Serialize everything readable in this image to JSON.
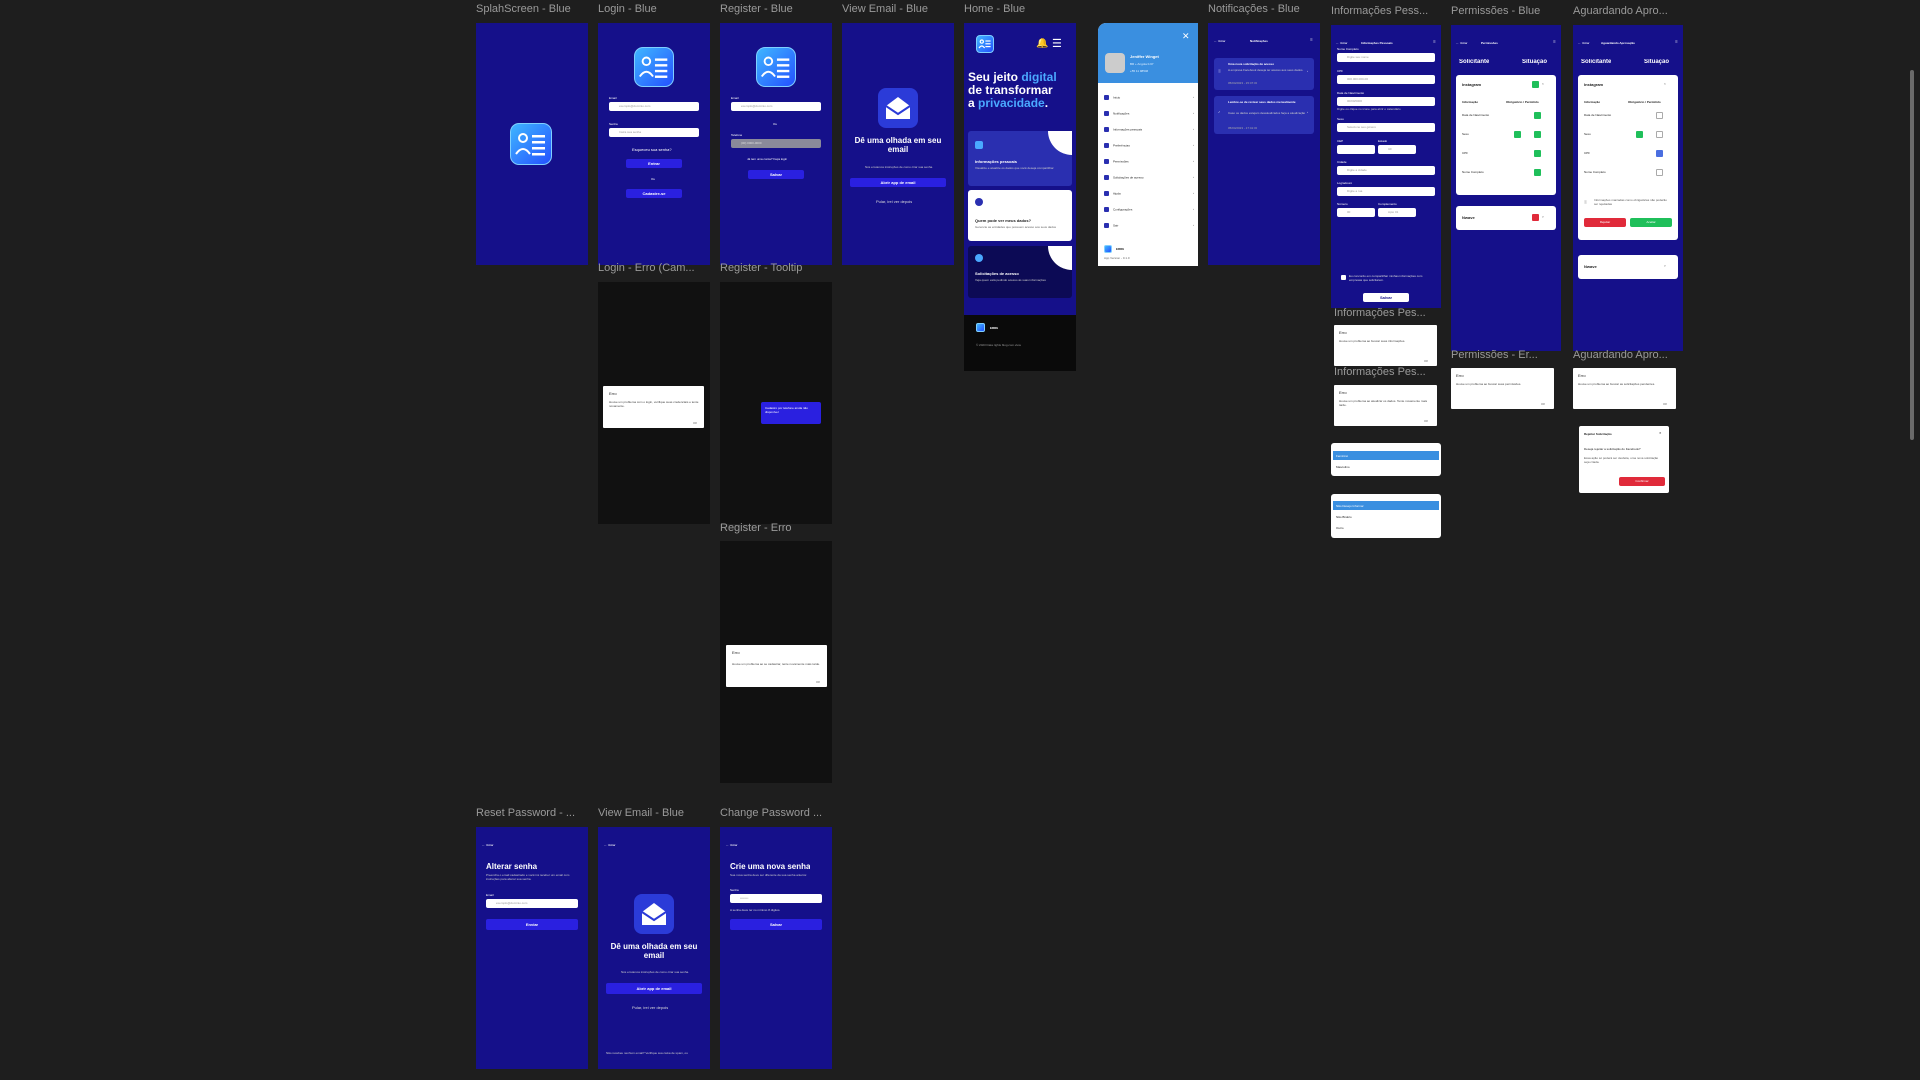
{
  "frames": {
    "splash": "SplahScreen - Blue",
    "login": "Login - Blue",
    "register": "Register - Blue",
    "view_email": "View Email - Blue",
    "home": "Home - Blue",
    "notifications": "Notificações - Blue",
    "personal_info": "Informações Pess...",
    "permissions": "Permissões - Blue",
    "awaiting": "Aguardando Apro...",
    "login_error": "Login - Erro (Cam...",
    "register_tooltip": "Register - Tooltip",
    "register_error": "Register - Erro",
    "personal_info_2": "Informações Pes...",
    "personal_info_3": "Informações Pes...",
    "permissions_error": "Permissões - Er...",
    "awaiting_2": "Aguardando Apro...",
    "reset_password": "Reset Password - ...",
    "view_email_2": "View Email - Blue",
    "change_password": "Change Password ..."
  },
  "login": {
    "email_label": "Email",
    "email_placeholder": "exemplo@dominio.com",
    "password_label": "Senha",
    "password_placeholder": "Insira sua senha",
    "forgot": "Esqueceu sua senha?",
    "enter": "Entrar",
    "or": "Ou",
    "register": "Cadastre-se"
  },
  "register": {
    "email_label": "Email",
    "email_placeholder": "exemplo@dominio.com",
    "or": "Ou",
    "phone_label": "Telefone",
    "phone_placeholder": "(00) 0000-0000",
    "have_account": "Já tem uma conta? Faça login",
    "save": "Salvar",
    "tooltip": "Cadastro por telefone ainda não disponível"
  },
  "view_email": {
    "title": "Dê uma olhada em seu email",
    "desc": "Nós enviamos instruções de como criar sua senha.",
    "open_app": "Abrir app de email",
    "skip": "Pular, irei ver depois",
    "footer": "Não recebeu nenhum email? Verifique sua caixa de spam, ou"
  },
  "home": {
    "hero_1": "Seu jeito ",
    "hero_2": "digital",
    "hero_3": "de transformar",
    "hero_4": "a ",
    "hero_5": "privacidade",
    "hero_6": ".",
    "card1_title": "Informações pessoais",
    "card1_desc": "Visualize e atualize os dados que você deseja compartilhar",
    "card2_title": "Quem pode ver meus dados?",
    "card2_desc": "Gerencie as entidades que possuem acesso aos seus dados",
    "card3_title": "Solicitações de acesso",
    "card3_desc": "Veja quem está pedindo acesso às suas informações",
    "brand": "ERRE",
    "copyright": "© 2023 Data rights blog.com.view"
  },
  "menu": {
    "user_name": "Jeniffer Winget",
    "user_sub": "BR + Angola 0-67",
    "user_phone": "+55 11 98546",
    "items": [
      "Início",
      "Notificações",
      "Informações pessoais",
      "Preferências",
      "Permissões",
      "Solicitações de acesso",
      "Ajuda",
      "Configurações",
      "Sair"
    ],
    "brand": "ERRE",
    "version": "App Version - 0.1.0"
  },
  "notifications": {
    "back": "Voltar",
    "title": "Notificações",
    "n1": "Uma nova solicitação de acesso",
    "n1_desc": "A empresa Facebook deseja ter acesso aos seus dados.",
    "n1_date": "05/04/2023 - 15:47:30",
    "n2": "Lembre-se de revisar seus dados mensalmente",
    "n2_desc": "Caso os dados estejam desatualizados faça a atualização",
    "n2_date": "05/04/2023 - 17:41:30"
  },
  "personal": {
    "back": "Voltar",
    "title": "Informações Pessoais",
    "f_name": "Nome Completo",
    "f_name_ph": "Digite seu nome",
    "f_cpf": "CPF",
    "f_cpf_ph": "000.000.000-00",
    "f_birth": "Data de Nascimento",
    "f_birth_ph": "00/00/0000",
    "f_birth_hint": "Digite ou clique no ícone para abrir o calendário",
    "f_gender": "Sexo",
    "f_gender_ph": "Selecione seu gênero",
    "f_cep": "CEP",
    "f_state": "Estado",
    "f_state_ph": "UF",
    "f_city": "Cidade",
    "f_city_ph": "Digite a cidade",
    "f_street": "Logradouro",
    "f_street_ph": "Digite a rua",
    "f_number": "Número",
    "f_compl": "Complemento",
    "f_number_ph": "00",
    "f_compl_ph": "Apto 01",
    "consent": "Eu concordo em compartilhar minhas informações com empresas que solicitarem.",
    "save": "Salvar",
    "err_title": "Erro",
    "err_fetch": "Houve um problema ao buscar suas informações.",
    "err_update": "Houve um problema ao atualizar os dados. Tente novamente mais tarde.",
    "ok": "OK",
    "dd1_opts": [
      "Feminino",
      "Masculino"
    ],
    "dd2_opts": [
      "Não Desejo Informar",
      "Não Binário",
      "Outro"
    ]
  },
  "permissions": {
    "back": "Voltar",
    "title": "Permissões",
    "col1": "Solicitante",
    "col2": "Situação",
    "company": "Instagram",
    "sub1": "Informação",
    "sub2": "Obrigatório / Permitido",
    "rows": [
      "Data de Nascimento",
      "Sexo",
      "CPF",
      "Nome Completo"
    ],
    "company2": "Nwave",
    "err": "Houve um problema ao buscar suas permissões."
  },
  "awaiting": {
    "back": "Voltar",
    "title": "Aguardando Aprovação",
    "col1": "Solicitante",
    "col2": "Situação",
    "company": "Instagram",
    "sub1": "Informação",
    "sub2": "Obrigatório / Permitido",
    "rows": [
      "Data de Nascimento",
      "Sexo",
      "CPF",
      "Nome Completo"
    ],
    "note": "Informações marcadas como obrigatórias não poderão ser rejeitadas",
    "reject": "Rejeitar",
    "accept": "Aceitar",
    "company2": "Nwave",
    "err": "Houve um problema ao buscar as solicitações pendentes.",
    "modal_title": "Rejeitar Solicitação",
    "modal_q": "Deseja rejeitar a solicitação do Facebook?",
    "modal_desc": "Essa ação só poderá ser desfeita, uma nova solicitação seja criada.",
    "confirm": "Confirmar"
  },
  "errors": {
    "title": "Erro",
    "login": "Houve um problema com o login, verifique suas credenciais e tente novamente.",
    "register": "Houve um problema ao se cadastrar, tente novamente mais tarde.",
    "ok": "OK"
  },
  "reset": {
    "back": "Voltar",
    "title": "Alterar senha",
    "desc": "Preencha o email cadastrado e você irá receber um email com instruções para alterar sua senha.",
    "email_label": "Email",
    "email_ph": "exemplo@dominio.com",
    "send": "Enviar"
  },
  "change_pw": {
    "back": "Voltar",
    "title": "Crie uma nova senha",
    "desc": "Sua nova senha deve ser diferente da sua senha anterior.",
    "pw_label": "Senha",
    "pw_ph": "••••••••",
    "hint": "A senha deve ter no mínimo 8 dígitos.",
    "save": "Salvar"
  },
  "colors": {
    "bg": "#1e1e1e",
    "primary": "#15108a",
    "accent": "#2a20e0",
    "success": "#1fbf5a",
    "danger": "#e02a3a"
  }
}
